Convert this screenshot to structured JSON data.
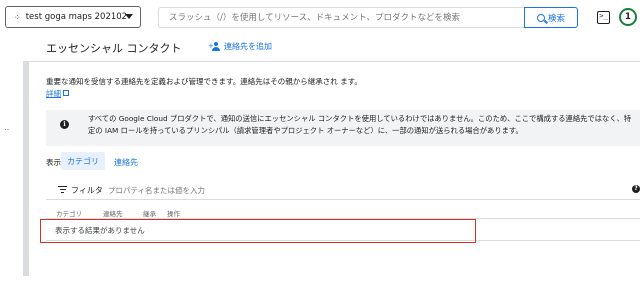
{
  "header": {
    "project_name": "test goga maps 202102",
    "search_placeholder": "スラッシュ（/）を使用してリソース、ドキュメント、プロダクトなどを検索",
    "search_button": "検索",
    "terminal_icon": "terminal-icon",
    "notification_count": "1",
    "notification_color": "#188038"
  },
  "page": {
    "title": "エッセンシャル コンタクト",
    "add_contact": "連絡先を追加",
    "description": "重要な通知を受信する連絡先を定義および管理できます。連絡先はその親から継承され ます。",
    "details_link": "詳細",
    "banner_text": "すべての Google Cloud プロダクトで、通知の送信にエッセンシャル コンタクトを使用しているわけではありません。このため、ここで構成する連絡先ではなく、特定の IAM ロールを持っているプリンシパル（請求管理者やプロジェクト オーナーなど）に、一部の通知が送られる場合があります。"
  },
  "view": {
    "label": "表示:",
    "options": [
      {
        "label": "カテゴリ",
        "selected": true
      },
      {
        "label": "連絡先",
        "selected": false
      }
    ]
  },
  "filter": {
    "label": "フィルタ",
    "placeholder": "プロパティ名または値を入力"
  },
  "table": {
    "columns": [
      "カテゴリ",
      "連絡先",
      "継承",
      "操作"
    ],
    "empty_message": "表示する結果がありません"
  },
  "colors": {
    "accent": "#1a73e8",
    "highlight": "#d93025",
    "banner_bg": "#f1f3f4"
  }
}
